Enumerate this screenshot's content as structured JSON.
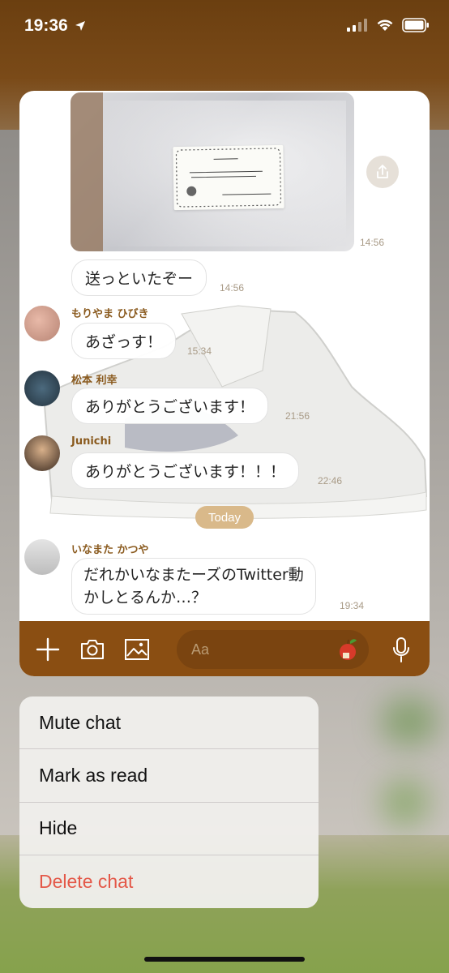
{
  "status_bar": {
    "time": "19:36"
  },
  "chat": {
    "photo_time": "14:56",
    "messages": [
      {
        "sender": "",
        "text": "送っといたぞー",
        "time": "14:56"
      },
      {
        "sender": "もりやま ひびき",
        "text": "あざっす！",
        "time": "15:34"
      },
      {
        "sender": "松本 利幸",
        "text": "ありがとうございます！",
        "time": "21:56"
      },
      {
        "sender": "Junichi",
        "text": "ありがとうございます！！！",
        "time": "22:46"
      }
    ],
    "date_divider": "Today",
    "last_message": {
      "sender": "いなまた かつや",
      "text_line1": "だれかいなまたーズのTwitter動",
      "text_line2": "かしとるんか…？",
      "time": "19:34"
    }
  },
  "composer": {
    "placeholder": "Aa"
  },
  "context_menu": {
    "items": [
      "Mute chat",
      "Mark as read",
      "Hide",
      "Delete chat"
    ]
  },
  "colors": {
    "header_brown": "#7a4a18",
    "composer_brown": "#8a4e12",
    "sender_name": "#8a5a1e",
    "today_pill": "#d9b98a",
    "delete_red": "#e45848"
  }
}
